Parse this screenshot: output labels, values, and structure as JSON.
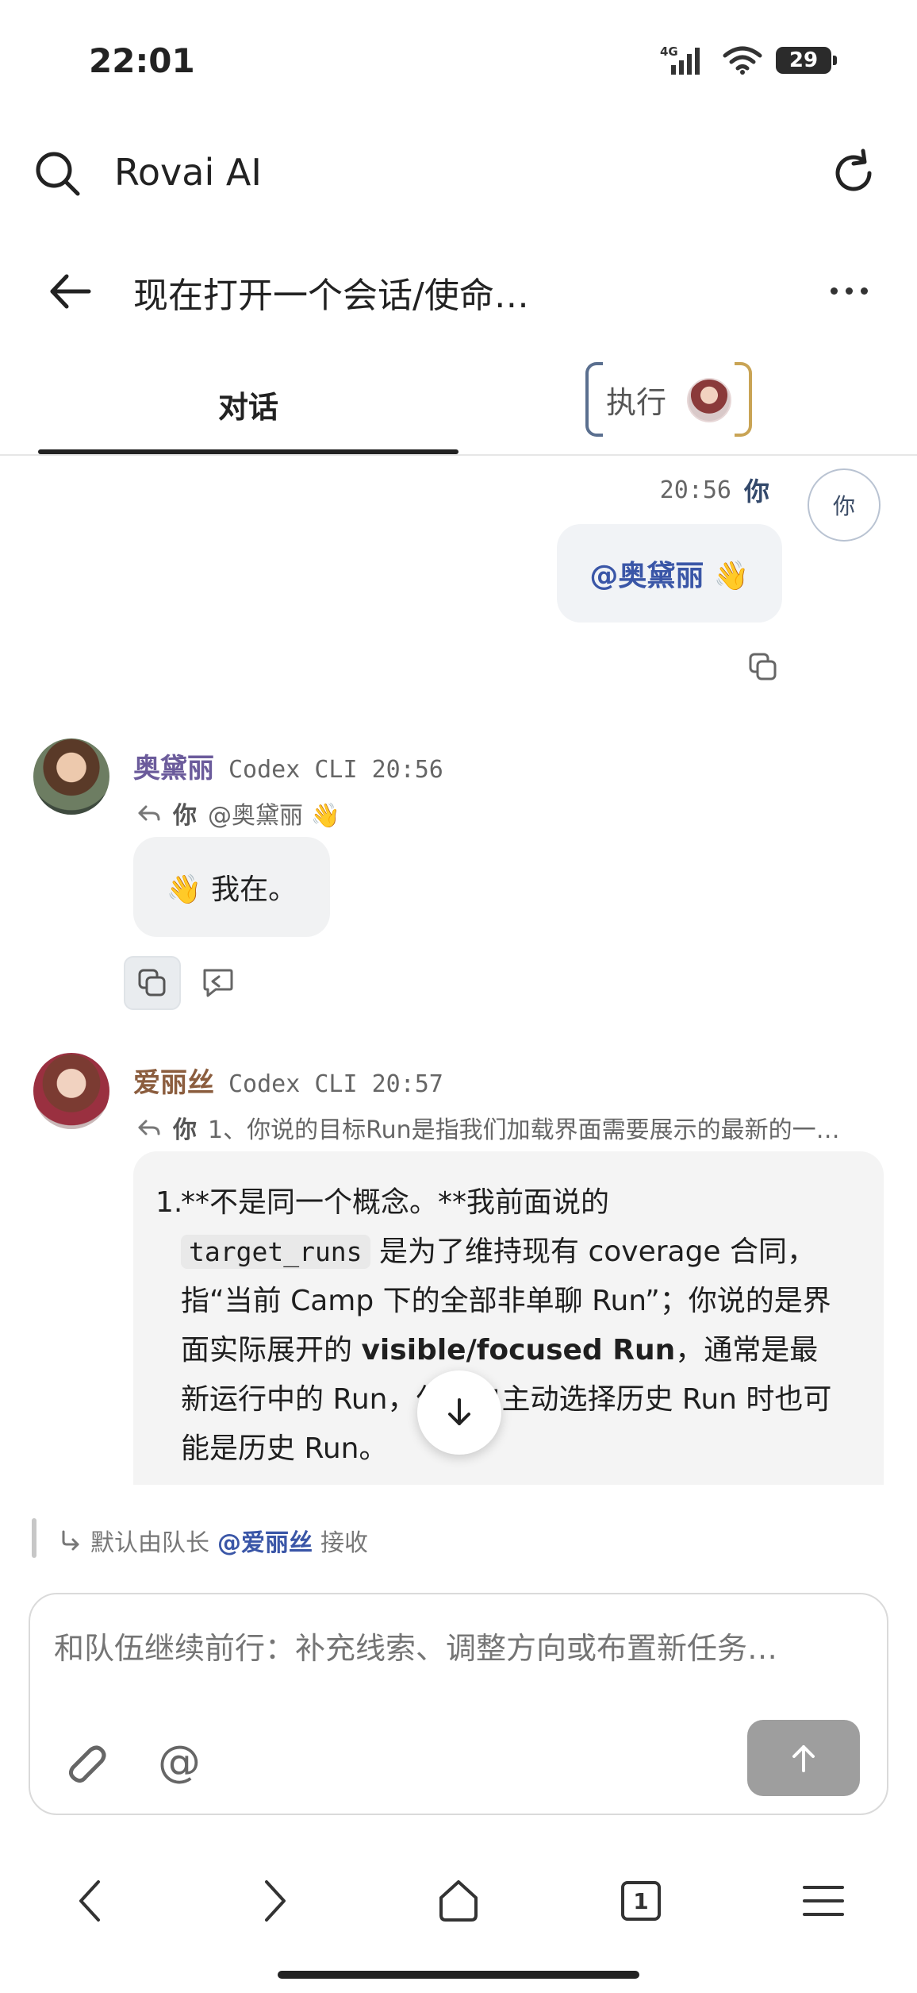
{
  "status_bar": {
    "time": "22:01",
    "network": "4G",
    "battery": "29",
    "icons": [
      "signal-icon",
      "wifi-icon",
      "battery-icon"
    ]
  },
  "browser": {
    "site_title": "Rovai AI",
    "icons": [
      "search-icon",
      "reload-icon"
    ]
  },
  "header": {
    "title": "现在打开一个会话/使命…",
    "icons": [
      "back-arrow-icon",
      "more-icon"
    ]
  },
  "tabs": [
    {
      "label": "对话",
      "active": true
    },
    {
      "label": "执行",
      "active": false
    }
  ],
  "messages": {
    "user": {
      "time": "20:56",
      "sender": "你",
      "avatar_text": "你",
      "text": "@奥黛丽 👋"
    },
    "odelie": {
      "name": "奥黛丽",
      "agent": "Codex CLI",
      "time": "20:56",
      "reply_to": "你",
      "reply_snippet": "@奥黛丽 👋",
      "text": "👋 我在。"
    },
    "alice": {
      "name": "爱丽丝",
      "agent": "Codex CLI",
      "time": "20:57",
      "reply_to": "你",
      "reply_snippet": "1、你说的目标Run是指我们加载界面需要展示的最新的一…",
      "list_number": "1.",
      "p1": "**不是同一个概念。**我前面说的",
      "code": "target_runs",
      "p2": "是为了维持现有 coverage 合同，指“当前 Camp 下的全部非单聊 Run”；你说的是界面实际展开的",
      "bold": "visible/focused Run",
      "p3": "，通常是最新运行中的 Run，但用户主动选择历史 Run 时也可能是历史 Run。"
    }
  },
  "hint": {
    "prefix": "默认由队长",
    "mention": "@爱丽丝",
    "suffix": "接收"
  },
  "composer": {
    "placeholder": "和队伍继续前行：补充线索、调整方向或布置新任务…",
    "mention_symbol": "@"
  },
  "bottom_nav": {
    "tab_count": "1"
  },
  "colors": {
    "mention_blue": "#3a56a7",
    "odelie_name": "#6b5b9b",
    "alice_name": "#8b5d3e",
    "send_button": "#9e9e9e"
  }
}
